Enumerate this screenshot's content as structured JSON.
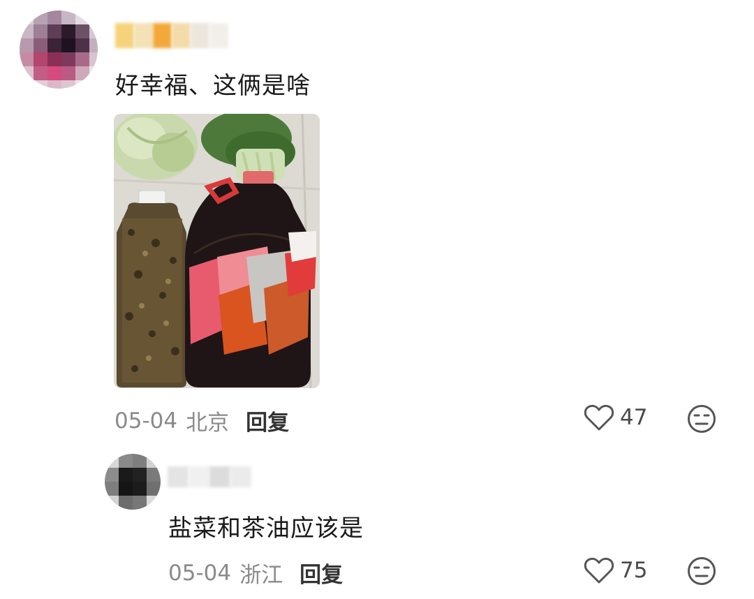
{
  "comments": [
    {
      "text": "好幸福、这俩是啥",
      "date": "05-04",
      "location": "北京",
      "reply_label": "回复",
      "likes": "47",
      "icons": {
        "like": "heart-outline-icon",
        "dislike": "meh-face-icon"
      }
    },
    {
      "text": "盐菜和茶油应该是",
      "date": "05-04",
      "location": "浙江",
      "reply_label": "回复",
      "likes": "75",
      "icons": {
        "like": "heart-outline-icon",
        "dislike": "meh-face-icon"
      }
    }
  ],
  "colors": {
    "meta_text": "#8a8a8a",
    "reply_text": "#333333",
    "icon_stroke": "#555555"
  }
}
